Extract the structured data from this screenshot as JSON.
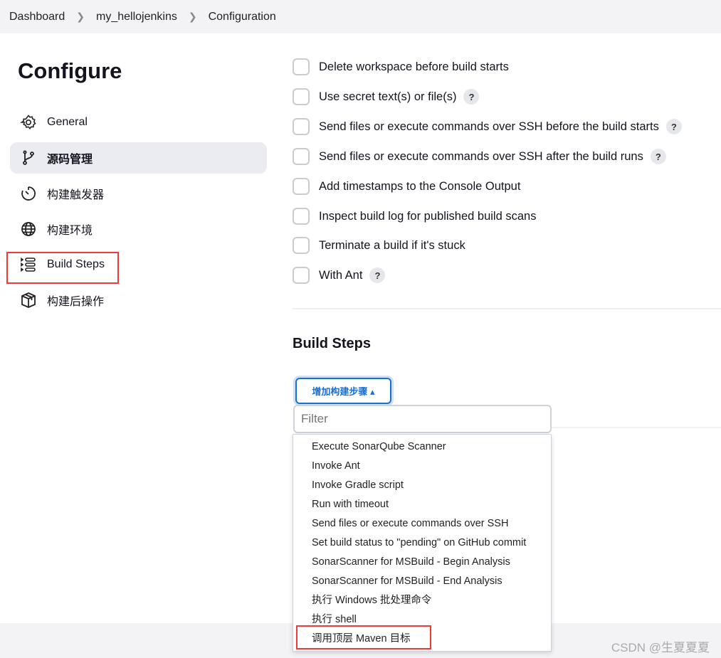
{
  "breadcrumb": [
    "Dashboard",
    "my_hellojenkins",
    "Configuration"
  ],
  "page_title": "Configure",
  "sidebar": {
    "items": [
      {
        "label": "General",
        "icon": "gear-icon"
      },
      {
        "label": "源码管理",
        "icon": "git-branch-icon",
        "active": true
      },
      {
        "label": "构建触发器",
        "icon": "timer-icon"
      },
      {
        "label": "构建环境",
        "icon": "globe-icon"
      },
      {
        "label": "Build Steps",
        "icon": "list-icon",
        "highlighted": true
      },
      {
        "label": "构建后操作",
        "icon": "package-icon"
      }
    ]
  },
  "options": [
    {
      "label": "Delete workspace before build starts",
      "checked": false,
      "help": false
    },
    {
      "label": "Use secret text(s) or file(s)",
      "checked": false,
      "help": true
    },
    {
      "label": "Send files or execute commands over SSH before the build starts",
      "checked": false,
      "help": true
    },
    {
      "label": "Send files or execute commands over SSH after the build runs",
      "checked": false,
      "help": true
    },
    {
      "label": "Add timestamps to the Console Output",
      "checked": false,
      "help": false
    },
    {
      "label": "Inspect build log for published build scans",
      "checked": false,
      "help": false
    },
    {
      "label": "Terminate a build if it's stuck",
      "checked": false,
      "help": false
    },
    {
      "label": "With Ant",
      "checked": false,
      "help": true
    }
  ],
  "help_label": "?",
  "build_steps": {
    "heading": "Build Steps",
    "add_button": "增加构建步骤 ▴",
    "filter_placeholder": "Filter",
    "menu": [
      "Execute SonarQube Scanner",
      "Invoke Ant",
      "Invoke Gradle script",
      "Run with timeout",
      "Send files or execute commands over SSH",
      "Set build status to \"pending\" on GitHub commit",
      "SonarScanner for MSBuild - Begin Analysis",
      "SonarScanner for MSBuild - End Analysis",
      "执行 Windows 批处理命令",
      "执行 shell",
      "调用顶层 Maven 目标"
    ]
  },
  "watermark": "CSDN @生夏夏夏",
  "colors": {
    "accent": "#1a6fd6",
    "highlight": "#f03a3a"
  }
}
